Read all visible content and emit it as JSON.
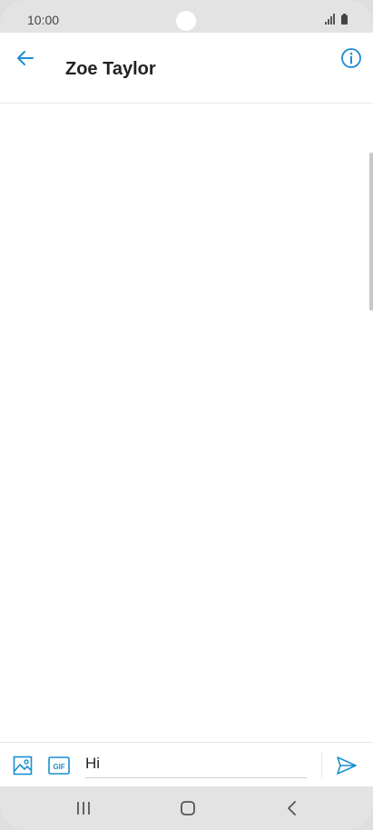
{
  "status_bar": {
    "time": "10:00",
    "icons": [
      "signal-icon",
      "battery-icon"
    ]
  },
  "header": {
    "contact_name": "Zoe Taylor",
    "back_icon": "back-arrow-icon",
    "info_icon": "info-icon"
  },
  "composer": {
    "message_value": "Hi",
    "attach_icon": "image-icon",
    "gif_icon": "gif-icon",
    "gif_label": "GIF",
    "send_icon": "send-icon"
  },
  "nav_bar": {
    "icons": [
      "recents-icon",
      "home-icon",
      "back-icon"
    ]
  },
  "colors": {
    "accent": "#1a8ed1",
    "text": "#222222",
    "chrome": "#e3e3e3"
  }
}
